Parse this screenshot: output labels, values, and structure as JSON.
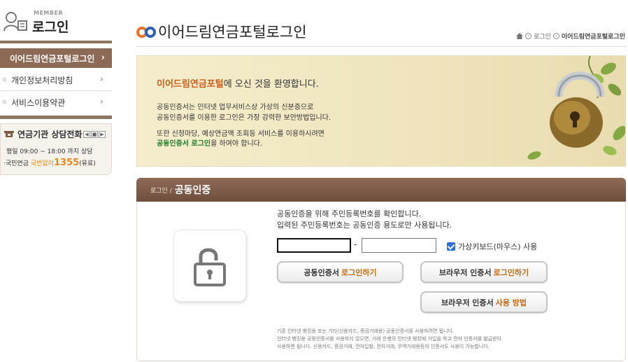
{
  "sidebar": {
    "member_small": "MEMBER",
    "member_title": "로그인",
    "items": [
      {
        "label": "이어드림연금포털로그인",
        "active": true
      },
      {
        "label": "개인정보처리방침",
        "active": false
      },
      {
        "label": "서비스이용약관",
        "active": false
      }
    ],
    "consult": {
      "title": "연금기관 상담전화",
      "hours": "평일 09:00 ~ 18:00 까지 상담",
      "phone_prefix": "·국민연금",
      "phone_sub": "국번없이",
      "phone_number": "1355",
      "phone_suffix": "(유료)"
    }
  },
  "header": {
    "title": "이어드림연금포털로그인",
    "breadcrumb": [
      "로그인",
      "이어드림연금포털로그인"
    ]
  },
  "banner": {
    "heading_highlight": "이어드림연금포털",
    "heading_rest": "에 오신 것을 환영합니다.",
    "line1": "공동인증서는 인터넷 업무서비스상 가상의 신분증으로",
    "line2": "공동인증서를 이용한 로그인은 가장 강력한 보안방법입니다.",
    "line3": "또한 신청마당, 예상연금액 조회등 서비스를 이용하시려면",
    "line4_highlight": "공동인증서 로그인",
    "line4_rest": "을 하여야 합니다."
  },
  "login_panel": {
    "crumb": "로그인 /",
    "title": "공동인증",
    "info1": "공동인증을 위해 주민등록번호를 확인합니다.",
    "info2": "입력된 주민등록번호는 공동인증 용도로만 사용됩니다.",
    "rrn_first_value": "",
    "rrn_second_value": "",
    "dash": "-",
    "virtual_keyboard_label": "가상키보드(마우스) 사용",
    "virtual_keyboard_checked": true,
    "btn_cert_prefix": "공동인증서",
    "btn_cert_highlight": "로그인하기",
    "btn_browser_prefix": "브라우저 인증서",
    "btn_browser_highlight": "로그인하기",
    "btn_howto_prefix": "브라우저 인증서",
    "btn_howto_highlight": "사용 방법",
    "note1": "기존 인터넷 뱅킹용 또는 기타(신용카드, 증권거래용) 공동인증서를 사용하려면 됩니다.",
    "note2": "인터넷 뱅킹용 공동인증서를 사용하지 않으면, 거래 은행의 인터넷 뱅킹에 가입을 하고 전자 인증서를 발급받아",
    "note3": "사용하면 됩니다. 신용카드, 증권거래, 전자입찰, 전자거래, 무역거래용등의 인증서도 사용이 가능합니다."
  },
  "colors": {
    "brand_brown": "#8c6a55",
    "highlight_orange": "#d25a1c",
    "highlight_green": "#1f7c2a",
    "phone_orange": "#e58a1f"
  }
}
